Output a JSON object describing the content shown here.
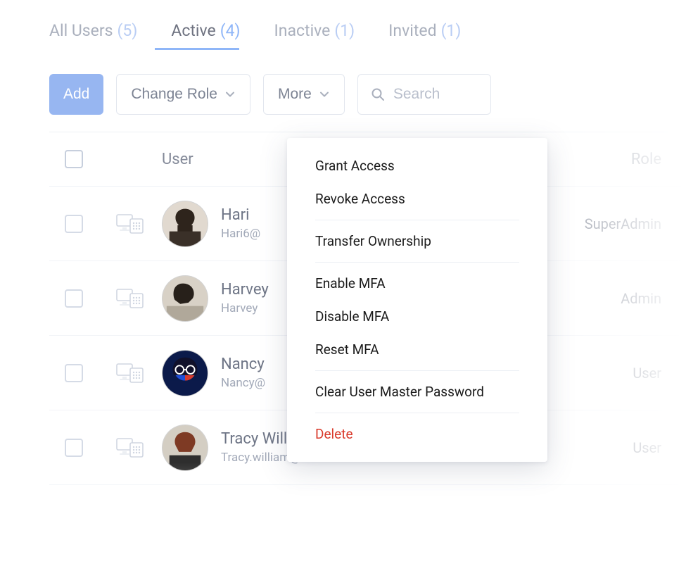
{
  "tabs": [
    {
      "label": "All Users",
      "count": "(5)",
      "active": false
    },
    {
      "label": "Active",
      "count": "(4)",
      "active": true
    },
    {
      "label": "Inactive",
      "count": "(1)",
      "active": false
    },
    {
      "label": "Invited",
      "count": "(1)",
      "active": false
    }
  ],
  "toolbar": {
    "add_label": "Add",
    "change_role_label": "Change Role",
    "more_label": "More",
    "search_placeholder": "Search"
  },
  "table": {
    "headers": {
      "user": "User",
      "role": "Role"
    },
    "rows": [
      {
        "name": "Hari",
        "email": "Hari6@",
        "role": "SuperAdmin"
      },
      {
        "name": "Harvey",
        "email": "Harvey",
        "role": "Admin"
      },
      {
        "name": "Nancy",
        "email": "Nancy@",
        "role": "User"
      },
      {
        "name": "Tracy William",
        "email": "Tracy.william@zohotest.com",
        "role": "User"
      }
    ]
  },
  "more_menu": {
    "groups": [
      [
        "Grant Access",
        "Revoke Access"
      ],
      [
        "Transfer Ownership"
      ],
      [
        "Enable MFA",
        "Disable MFA",
        "Reset MFA"
      ],
      [
        "Clear User Master Password"
      ]
    ],
    "danger": "Delete"
  }
}
